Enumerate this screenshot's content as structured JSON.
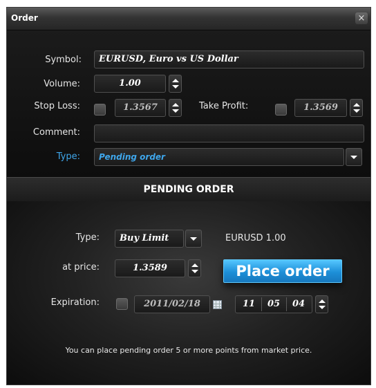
{
  "window": {
    "title": "Order",
    "close_glyph": "×"
  },
  "form": {
    "symbol_label": "Symbol:",
    "symbol_value": "EURUSD, Euro vs US Dollar",
    "volume_label": "Volume:",
    "volume_value": "1.00",
    "stop_loss_label": "Stop Loss:",
    "stop_loss_value": "1.3567",
    "stop_loss_checked": false,
    "take_profit_label": "Take Profit:",
    "take_profit_value": "1.3569",
    "take_profit_checked": false,
    "comment_label": "Comment:",
    "comment_value": "",
    "type_label": "Type:",
    "type_value": "Pending order"
  },
  "pending": {
    "header": "PENDING ORDER",
    "type_label": "Type:",
    "type_value": "Buy Limit",
    "instrument_info": "EURUSD 1.00",
    "price_label": "at price:",
    "price_value": "1.3589",
    "place_button": "Place order",
    "expiration_label": "Expiration:",
    "expiration_checked": false,
    "expiration_date": "2011/02/18",
    "expiration_hour": "11",
    "expiration_minute": "05",
    "expiration_second": "04",
    "note": "You can place pending order 5 or more points from market price."
  },
  "colors": {
    "accent_blue": "#3fa7ec",
    "button_blue": "#1d8fd8",
    "panel_dark": "#101010"
  },
  "icons": [
    "close-icon",
    "spin-up-icon",
    "spin-down-icon",
    "dropdown-arrow-icon",
    "calendar-icon",
    "checkbox-icon"
  ]
}
